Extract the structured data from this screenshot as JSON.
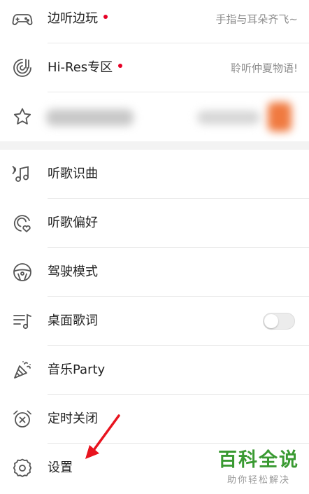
{
  "colors": {
    "dot": "#e60026",
    "text": "#222222",
    "subtext": "#8c8c8c",
    "icon": "#555555",
    "arrow": "#e8141f",
    "watermark": "#3a9a32"
  },
  "menu": {
    "game": {
      "label": "边听边玩",
      "right": "手指与耳朵齐飞~",
      "icon": "gamepad-icon",
      "has_dot": true
    },
    "hires": {
      "label": "Hi-Res专区",
      "right": "聆听仲夏物语!",
      "icon": "hires-disc-icon",
      "has_dot": true
    },
    "favorite": {
      "icon": "star-icon",
      "blurred": true
    },
    "recognize": {
      "label": "听歌识曲",
      "icon": "music-recognize-icon"
    },
    "preference": {
      "label": "听歌偏好",
      "icon": "preference-heart-icon"
    },
    "driving": {
      "label": "驾驶模式",
      "icon": "steering-wheel-icon"
    },
    "lyrics": {
      "label": "桌面歌词",
      "icon": "lyrics-icon",
      "toggle_on": false
    },
    "party": {
      "label": "音乐Party",
      "icon": "party-cone-icon"
    },
    "timer": {
      "label": "定时关闭",
      "icon": "alarm-clock-icon"
    },
    "settings": {
      "label": "设置",
      "icon": "gear-icon"
    }
  },
  "watermark": {
    "main": "百科全说",
    "sub": "助你轻松解决"
  }
}
